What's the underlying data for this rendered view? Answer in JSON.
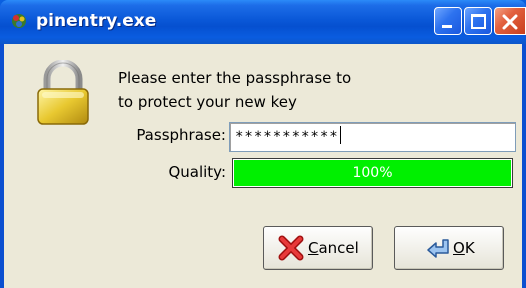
{
  "window": {
    "title": "pinentry.exe"
  },
  "dialog": {
    "description_line1": "Please enter the passphrase to",
    "description_line2": "to protect your new key",
    "passphrase_label": "Passphrase:",
    "passphrase_value": "***********",
    "quality_label": "Quality:",
    "quality_text": "100%",
    "quality_fraction": 1.0,
    "quality_color": "#00f000"
  },
  "buttons": {
    "cancel_label": "Cancel",
    "cancel_mnemonic": "C",
    "ok_label": "OK",
    "ok_mnemonic": "O"
  },
  "icons": {
    "app": "app-icon",
    "lock": "padlock-icon",
    "cancel": "red-x-icon",
    "ok": "arrow-left-icon",
    "minimize": "minimize-icon",
    "maximize": "maximize-icon",
    "close": "close-icon"
  },
  "colors": {
    "titlebar": "#0a58d8",
    "dialog_bg": "#ece9d8",
    "close_button": "#e2603e"
  }
}
